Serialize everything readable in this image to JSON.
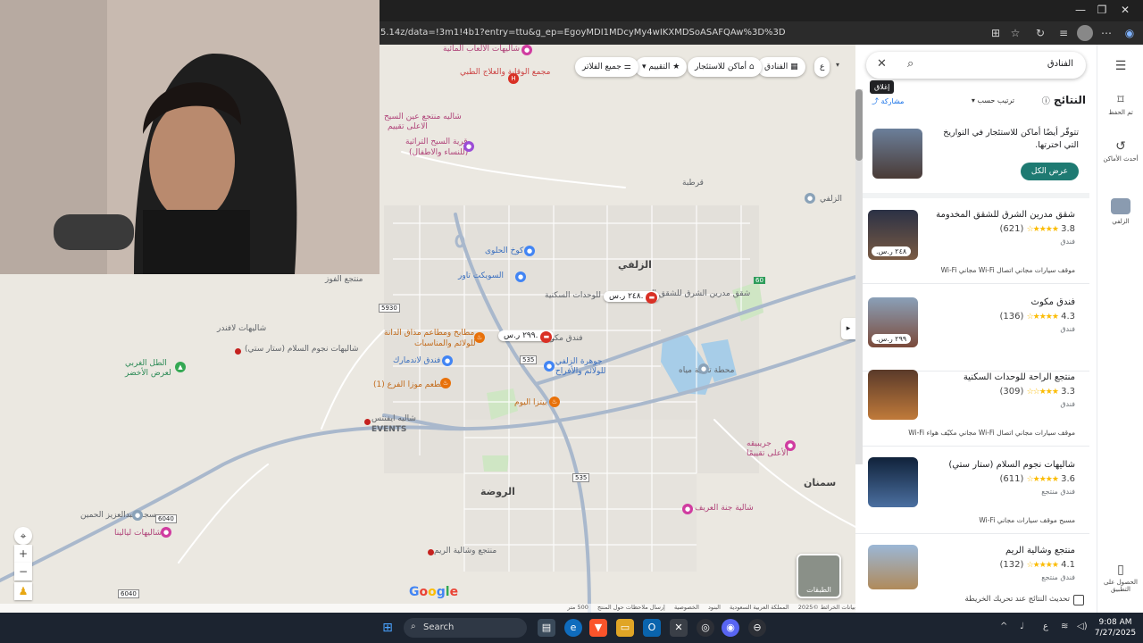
{
  "browser": {
    "url": "5.14z/data=!3m1!4b1?entry=ttu&g_ep=EgoyMDI1MDcyMy4wIKXMDSoASAFQAw%3D%3D"
  },
  "map": {
    "chips": {
      "hotels": "الفنادق",
      "rentals": "أماكن للاستئجار",
      "rating": "التقييم",
      "all_filters": "جميع الفلاتر",
      "tab_collapsed": "ع"
    },
    "labels": {
      "l1": "شاليهات الالعاب المائية",
      "l2": "مجمع الوقاية والعلاج الطبي",
      "l3": "شاليه منتجع عين السيح",
      "l3b": "الاعلى تقييم",
      "l4": "قرية السيح التراثية",
      "l4b": "(للنساء والاطفال)",
      "l5": "كوخ الحلوى",
      "l6": "السويكت تاور",
      "l7": "الزلفي",
      "l8": "منتجع الفوز",
      "l9": "شاليهات لافندر",
      "l10": "شاليهات نجوم السلام (ستار ستي)",
      "l11": "الطل الغربي",
      "l11b": "لعرض الأخضر",
      "l12": "مطابخ ومطاعم مذاق الدانة",
      "l12b": "للولائم والمناسبات",
      "l13": "فندق لاندمارك",
      "l14": "مطعم موزا الفرع (1)",
      "l15": "شاليه ايفنتس",
      "l15b": "EVENTS",
      "l16": "منتجع الراحة للوحدات السكنية",
      "l17": "شقق مدرين الشرق للشقق المخدومة",
      "l18": "فندق مكوث",
      "l19": "جوهرة الزلفي",
      "l19b": "للولائم والأفراح",
      "l20": "بيتزا اليوم",
      "l21": "محطة تحلية مياه",
      "l22": "جريبيقه",
      "l22b": "الأعلى تقييمًا",
      "l23": "الروضة",
      "l24": "سمنان",
      "l25": "شالية جنة العريف",
      "l26": "مسجد عبدالعزيز الحمين",
      "l27": "شاليهات ليالينا",
      "l28": "منتجع وشالية الريم",
      "l29": "الزلفي",
      "l30": "قرطبة"
    },
    "price_tags": {
      "p1": "٢٤٨ ر.س.",
      "p2": "٢٩٩ ر.س."
    },
    "road_numbers": {
      "r1": "5930",
      "r2": "535",
      "r3": "535",
      "r4": "6040",
      "r5": "6040",
      "r6": "60"
    },
    "layers_label": "الطبقات",
    "google": "Google",
    "footer": {
      "f1": "بيانات الخرائط ©2025",
      "f2": "المملكة العربية السعودية",
      "f3": "البنود",
      "f4": "الخصوصية",
      "f5": "إرسال ملاحظات حول المنتج",
      "scale": "500 متر"
    },
    "controls": {
      "locate": "⌖",
      "zoom_in": "+",
      "zoom_out": "−",
      "pegman": "♟"
    }
  },
  "panel": {
    "search_query": "الفنادق",
    "close_tooltip": "إغلاق",
    "results_title": "النتائج",
    "sort_label": "ترتيب حسب",
    "share_label": "مشاركة",
    "promo_text": "تتوفّر أيضًا أماكن للاستئجار في التواريخ التي اخترتها.",
    "promo_button": "عرض الكل",
    "results": [
      {
        "name": "شقق مدرين الشرق للشقق المخدومة",
        "rating": "3.8",
        "reviews": "(621)",
        "type": "فندق",
        "price": "٢٤٨ ر.س.",
        "amenities": "موقف سيارات مجاني   اتصال Wi-Fi مجاني   Wi-Fi"
      },
      {
        "name": "فندق مكوث",
        "rating": "4.3",
        "reviews": "(136)",
        "type": "فندق",
        "price": "٢٩٩ ر.س.",
        "amenities": ""
      },
      {
        "name": "منتجع الراحة للوحدات السكنية",
        "rating": "3.3",
        "reviews": "(309)",
        "type": "فندق",
        "price": "",
        "amenities": "موقف سيارات مجاني   اتصال Wi-Fi مجاني   مكيّف هواء   Wi-Fi"
      },
      {
        "name": "شاليهات نجوم السلام (ستار ستي)",
        "rating": "3.6",
        "reviews": "(611)",
        "type": "فندق منتجع",
        "price": "",
        "amenities": "مسبح   موقف سيارات مجاني   Wi-Fi"
      },
      {
        "name": "منتجع وشالية الريم",
        "rating": "4.1",
        "reviews": "(132)",
        "type": "فندق منتجع",
        "price": "",
        "amenities": ""
      }
    ],
    "update_results": "تحديث النتائج عند تحريك الخريطة"
  },
  "rail": {
    "saved": "تم الحفظ",
    "recent": "أحدث الأماكن",
    "zulfi": "الزلفي",
    "get_app": "الحصول على التطبيق"
  },
  "taskbar": {
    "search": "Search",
    "lang": "ع",
    "time": "9:08 AM",
    "date": "7/27/2025"
  },
  "colors": {
    "accent": "#1e7a72",
    "star": "#fbbc04",
    "map_bg": "#ebe8e1",
    "road": "#a9b8cc"
  }
}
